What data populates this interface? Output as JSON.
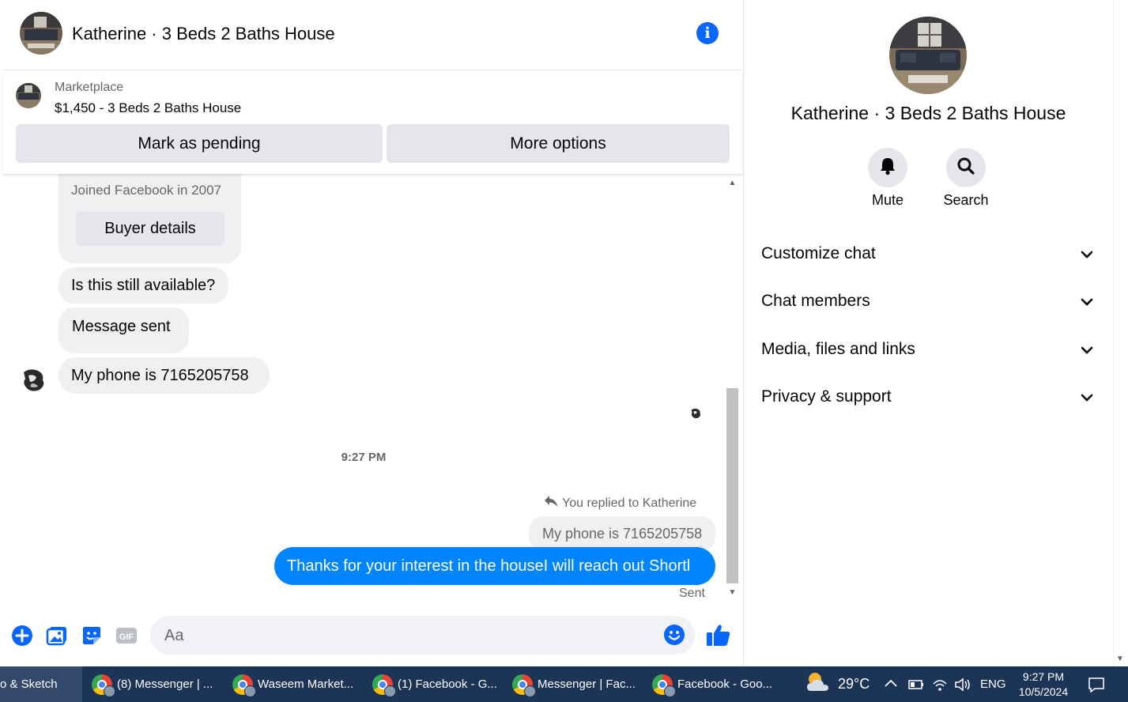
{
  "header": {
    "title": "Katherine · 3 Beds 2 Baths House"
  },
  "marketplace": {
    "label": "Marketplace",
    "listing": "$1,450 - 3 Beds 2 Baths House",
    "mark_pending": "Mark as pending",
    "more_options": "More options"
  },
  "messages": {
    "joined": "Joined Facebook in 2007",
    "buyer_details": "Buyer details",
    "m1": "Is this still available?",
    "m2": "Message sent",
    "m3": "My  phone is 7165205758",
    "time": "9:27 PM",
    "reply_note": "You replied to Katherine",
    "quoted": "My  phone is 7165205758",
    "sent_text": "Thanks for your interest in the houseI will reach out Shortl",
    "sent_status": "Sent"
  },
  "composer": {
    "placeholder": "Aa"
  },
  "panel": {
    "name": "Katherine · 3 Beds 2 Baths House",
    "mute": "Mute",
    "search": "Search",
    "sections": [
      "Customize chat",
      "Chat members",
      "Media, files and links",
      "Privacy & support"
    ]
  },
  "taskbar": {
    "items": [
      "o & Sketch",
      "(8) Messenger | ...",
      "Waseem Market...",
      "(1) Facebook - G...",
      "Messenger | Fac...",
      "Facebook - Goo..."
    ],
    "temp": "29°C",
    "lang": "ENG",
    "time": "9:27 PM",
    "date": "10/5/2024"
  },
  "colors": {
    "accent": "#0084ff",
    "info": "#0866ff",
    "taskbar": "#1c3556"
  }
}
